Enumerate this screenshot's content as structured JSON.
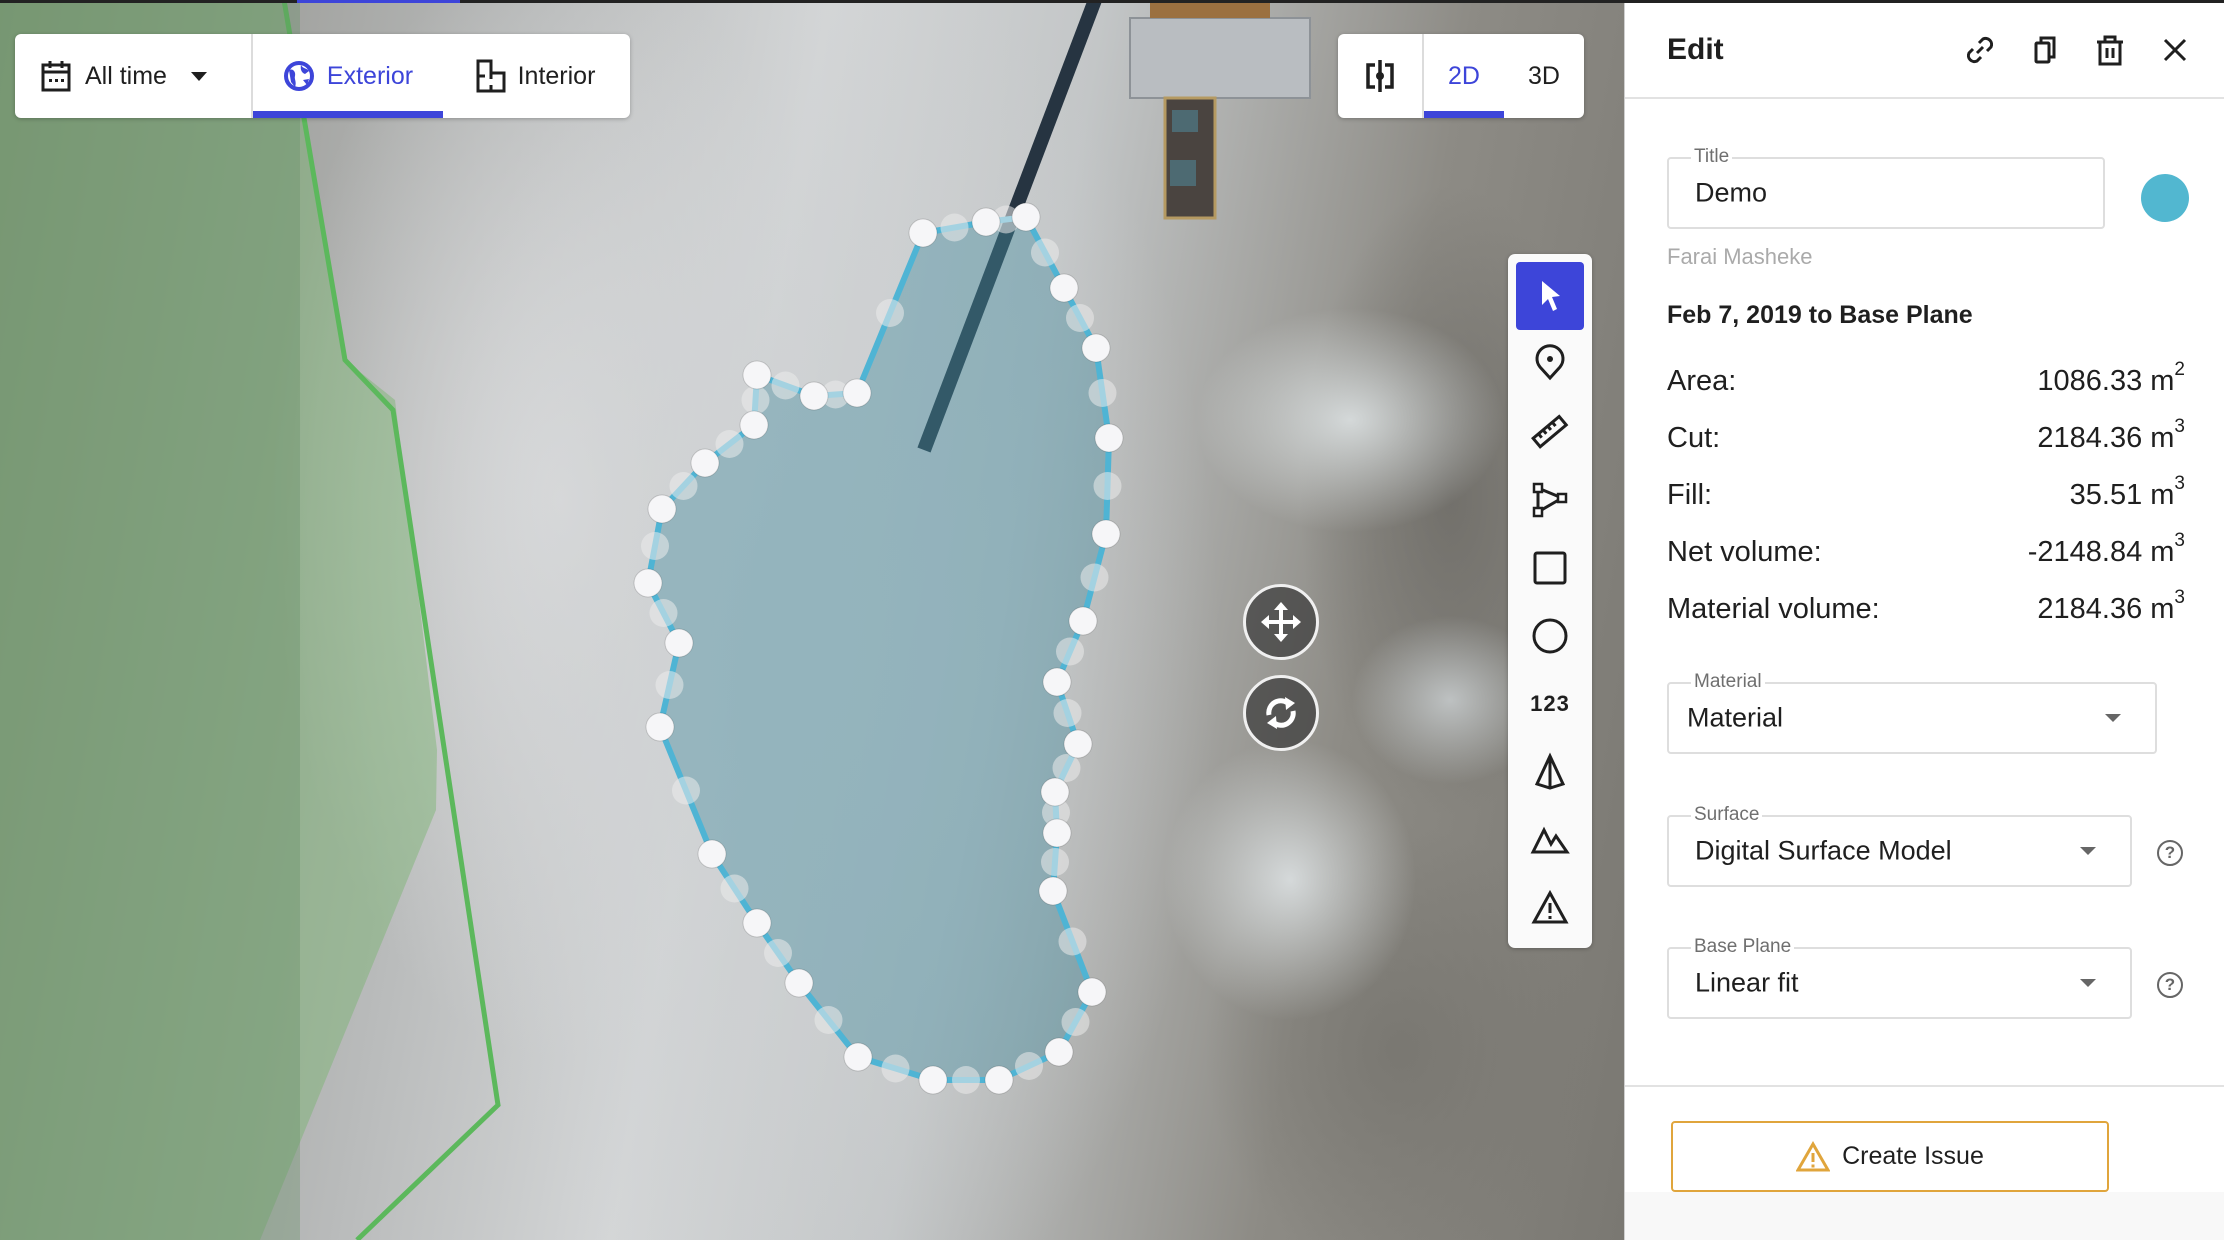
{
  "view_controls": {
    "time_filter": {
      "label": "All time",
      "icon": "calendar-icon"
    },
    "tabs": [
      {
        "label": "Exterior",
        "icon": "globe-icon",
        "active": true
      },
      {
        "label": "Interior",
        "icon": "floorplan-icon",
        "active": false
      }
    ]
  },
  "dimension_controls": {
    "split_icon": "compare-split-icon",
    "tabs": [
      {
        "label": "2D",
        "active": true
      },
      {
        "label": "3D",
        "active": false
      }
    ]
  },
  "toolbar": {
    "tools": [
      {
        "name": "select",
        "icon": "cursor-icon",
        "active": true
      },
      {
        "name": "marker",
        "icon": "location-pin-icon"
      },
      {
        "name": "measure",
        "icon": "ruler-icon"
      },
      {
        "name": "polyline",
        "icon": "polyline-icon"
      },
      {
        "name": "rectangle",
        "icon": "square-icon"
      },
      {
        "name": "circle",
        "icon": "circle-icon"
      },
      {
        "name": "count",
        "icon": "count-icon",
        "text": "123"
      },
      {
        "name": "volume",
        "icon": "pyramid-icon"
      },
      {
        "name": "elevation-profile",
        "icon": "mountain-icon"
      },
      {
        "name": "issue",
        "icon": "warning-icon"
      }
    ]
  },
  "map": {
    "selected_polygon_color": "#4fb4d4",
    "boundary_color": "#5cb85c",
    "handles": {
      "move": "move-arrows-icon",
      "rotate": "rotate-icon"
    }
  },
  "panel": {
    "title": "Edit",
    "header_icons": [
      "link-icon",
      "copy-icon",
      "trash-icon",
      "close-icon"
    ],
    "title_field": {
      "label": "Title",
      "value": "Demo"
    },
    "color": "#52b7d0",
    "author": "Farai Masheke",
    "comparison": "Feb 7, 2019 to Base Plane",
    "stats": [
      {
        "label": "Area:",
        "value": "1086.33 m",
        "unit_power": "2"
      },
      {
        "label": "Cut:",
        "value": "2184.36 m",
        "unit_power": "3"
      },
      {
        "label": "Fill:",
        "value": "35.51 m",
        "unit_power": "3"
      },
      {
        "label": "Net volume:",
        "value": "-2148.84 m",
        "unit_power": "3"
      },
      {
        "label": "Material volume:",
        "value": "2184.36 m",
        "unit_power": "3"
      }
    ],
    "material": {
      "label": "Material",
      "value": "Material"
    },
    "surface": {
      "label": "Surface",
      "value": "Digital Surface Model"
    },
    "base_plane": {
      "label": "Base Plane",
      "value": "Linear fit"
    },
    "help_glyph": "?",
    "create_issue": {
      "label": "Create Issue",
      "accent": "#e0a53c"
    }
  }
}
